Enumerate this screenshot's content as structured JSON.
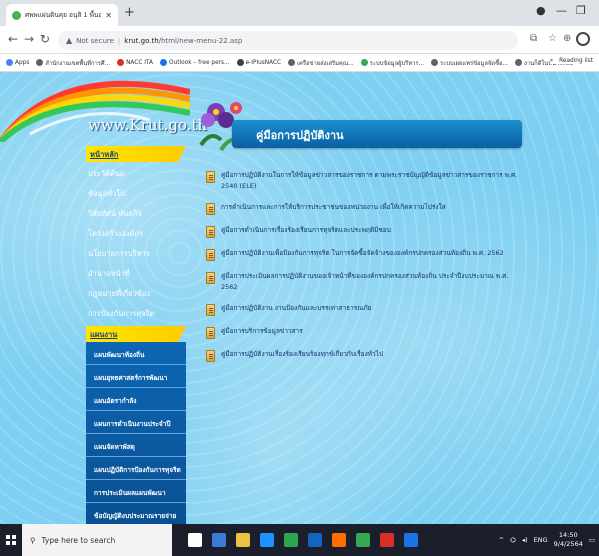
{
  "browser": {
    "tab_title": "ศพพแผ่นดินคุย อนุสิ 1 พื้นอศูล",
    "tab_close": "✕",
    "new_tab": "+",
    "url_warning": "Not secure",
    "url_separator": "|",
    "url_host": "krut.go.th",
    "url_path": "/html/new-menu-22.asp",
    "bookmarks": [
      {
        "label": "Apps",
        "color": "#4285f4"
      },
      {
        "label": "สำนักงานเขตพื้นที่การศึ...",
        "color": "#5f6368"
      },
      {
        "label": "NACC ITA",
        "color": "#d93025"
      },
      {
        "label": "Outlook – free pers...",
        "color": "#1a73e8"
      },
      {
        "label": "e-IPlusNACC",
        "color": "#3c4043"
      },
      {
        "label": "เครือข่ายส่งเสริมคุณ...",
        "color": "#5f6368"
      },
      {
        "label": "ระบบข้อมูลผู้บริหาร...",
        "color": "#34a853"
      },
      {
        "label": "ระบบเผยแพร่ข้อมูลจัดซื้อ...",
        "color": "#5f6368"
      },
      {
        "label": "งานก็ดีในหน้าระบบ",
        "color": "#5f6368"
      }
    ],
    "bookmarks_more": "»",
    "reading_list": "Reading list"
  },
  "site": {
    "logo": "www.Krut.go.th",
    "page_title": "คู่มือการปฏิบัติงาน",
    "sidebar_section_main": "หน้าหลัก",
    "sidebar_main_items": [
      "ประวัติค้นม",
      "ข้อมูลทั่วไป",
      "วิสัยทัศน์ พันธกิจ",
      "โครงสร้างองค์กร",
      "นโยบายการบริหาร",
      "อำนาจหน้าที่",
      "กฎหมายที่เกี่ยวข้อง",
      "การป้องกันการทุจริต"
    ],
    "sidebar_section_plan": "แผนงาน",
    "sidebar_plan_items": [
      "แผนพัฒนาท้องถิ่น",
      "แผนยุทธศาสตร์การพัฒนา",
      "แผนอัตรากำลัง",
      "แผนการดำเนินงานประจำปี",
      "แผนจัดหาพัสดุ",
      "แผนปฏิบัติการป้องกันการทุจริต",
      "การประเมินผลแผนพัฒนา",
      "ข้อบัญญัติงบประมาณรายจ่าย"
    ],
    "documents": [
      "คู่มือการปฏิบัติงานในการให้ข้อมูลข่าวสารของราชการ ตามพระราชบัญญัติข้อมูลข่าวสารของราชการ พ.ศ. 2540 (ELE)",
      "การดำเนินการและการให้บริการประชาชนของหน่วยงาน เพื่อให้เกิดความโปร่งใส",
      "คู่มือการดำเนินการเรื่องร้องเรียนการทุจริตและประพฤติมิชอบ",
      "คู่มือการปฏิบัติงานเพื่อป้องกันการทุจริต ในการจัดซื้อจัดจ้างขององค์กรปกครองส่วนท้องถิ่น พ.ศ. 2562",
      "คู่มือการประเมินผลการปฏิบัติงานของเจ้าหน้าที่ขององค์กรปกครองส่วนท้องถิ่น ประจำปีงบประมาณ พ.ศ. 2562",
      "คู่มือการปฏิบัติงาน งานป้องกันและบรรเทาสาธารณภัย",
      "คู่มือการบริการข้อมูลข่าวสาร",
      "คู่มือการปฏิบัติงานเรื่องร้องเรียนร้องทุกข์เกี่ยวกับเรื่องทั่วไป"
    ]
  },
  "taskbar": {
    "search_placeholder": "Type here to search",
    "language": "ENG",
    "time": "14:50",
    "date": "9/4/2564",
    "app_colors": [
      "#ffffff",
      "#3a7bd5",
      "#f0c040",
      "#1e90ff",
      "#2ea44f",
      "#1565c0",
      "#ff6f00",
      "#34a853",
      "#d93025",
      "#1a73e8"
    ]
  },
  "colors": {
    "page_background": "#7ecff1",
    "title_bar": "#0b5fa3",
    "sidebar_head": "#ffe600"
  }
}
